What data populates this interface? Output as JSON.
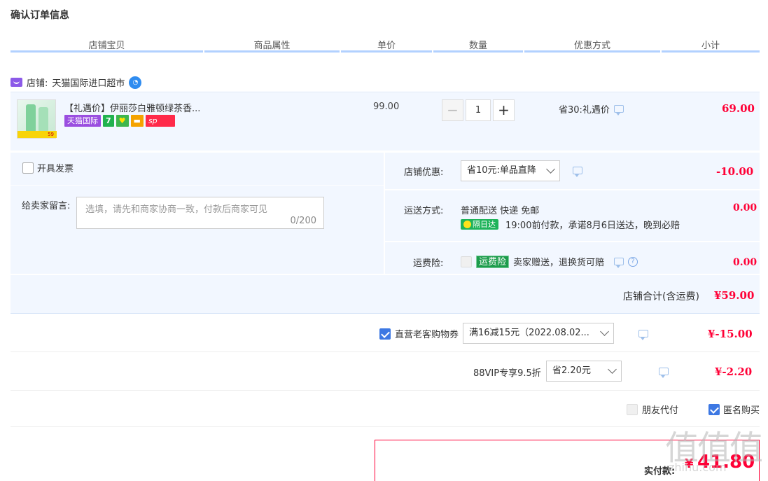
{
  "page_title": "确认订单信息",
  "columns": [
    "店铺宝贝",
    "商品属性",
    "单价",
    "数量",
    "优惠方式",
    "小计"
  ],
  "shop": {
    "label": "店铺:",
    "name": "天猫国际进口超市"
  },
  "item": {
    "name": "【礼遇价】伊丽莎白雅顿绿茶香...",
    "badges": [
      "天猫国际",
      "7",
      "♥",
      "▬",
      "sp"
    ],
    "thumb_price_tag": "59",
    "unit_price": "99.00",
    "quantity": "1",
    "promo": "省30:礼遇价",
    "subtotal": "69.00"
  },
  "invoice": {
    "label": "开具发票"
  },
  "message": {
    "label": "给卖家留言:",
    "placeholder": "选填，请先和商家协商一致，付款后商家可见",
    "counter": "0/200"
  },
  "shop_discount": {
    "label": "店铺优惠:",
    "selected": "省10元:单品直降",
    "amount": "-10.00"
  },
  "shipping": {
    "label": "运送方式:",
    "method": "普通配送 快递 免邮",
    "badge": "隔日达",
    "note": "19:00前付款，承诺8月6日送达，晚到必赔",
    "amount": "0.00"
  },
  "insurance": {
    "label": "运费险:",
    "badge": "运费险",
    "text": "卖家赠送，退换货可赔",
    "q": "?",
    "amount": "0.00"
  },
  "shop_total": {
    "label": "店铺合计(含运费)",
    "amount": "¥59.00"
  },
  "coupon": {
    "label": "直营老客购物券",
    "selected": "满16减15元（2022.08.02...",
    "amount": "¥-15.00"
  },
  "vip": {
    "label": "88VIP专享9.5折",
    "selected": "省2.20元",
    "amount": "¥-2.20"
  },
  "friend_pay": {
    "label": "朋友代付"
  },
  "anonymous": {
    "label": "匿名购买"
  },
  "payment": {
    "label": "实付款:",
    "currency": "¥",
    "amount": "41.80"
  },
  "watermark": {
    "mark": "值值值",
    "site": "zhihu.com"
  }
}
